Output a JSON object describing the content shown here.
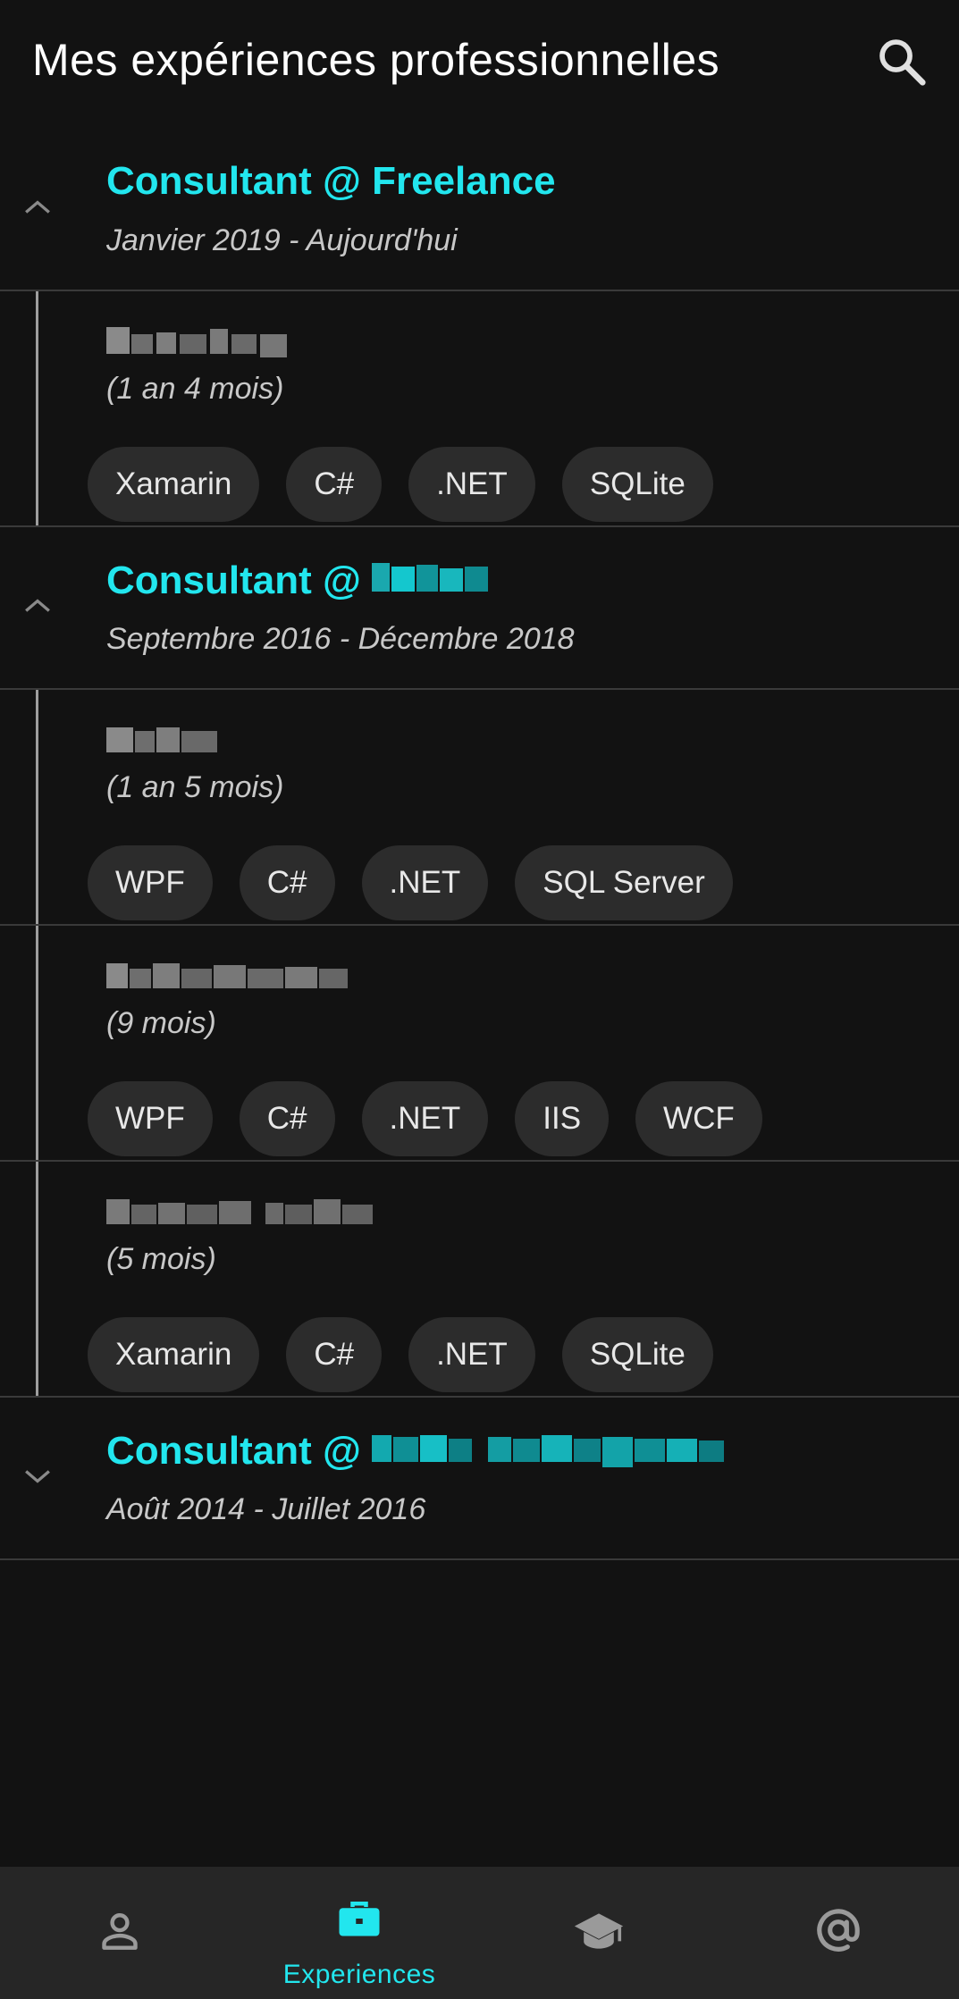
{
  "header": {
    "title": "Mes expériences professionnelles",
    "search_icon": "search-icon"
  },
  "groups": [
    {
      "company": "Consultant @ Freelance",
      "period": "Janvier 2019 - Aujourd'hui",
      "expanded": true,
      "entries": [
        {
          "client": "Bevolving",
          "duration": "(1 an 4 mois)",
          "tags": [
            "Xamarin",
            "C#",
            ".NET",
            "SQLite"
          ]
        }
      ]
    },
    {
      "company_prefix": "Consultant @ ",
      "company_name_redacted": "Prodis",
      "period": "Septembre 2016 - Décembre 2018",
      "expanded": true,
      "entries": [
        {
          "client": "Vitalis",
          "duration": "(1 an 5 mois)",
          "tags": [
            "WPF",
            "C#",
            ".NET",
            "SQL Server"
          ]
        },
        {
          "client": "G-Smartware",
          "duration": "(9 mois)",
          "tags": [
            "WPF",
            "C#",
            ".NET",
            "IIS",
            "WCF"
          ]
        },
        {
          "client": "Bernardaux Labs",
          "duration": "(5 mois)",
          "tags": [
            "Xamarin",
            "C#",
            ".NET",
            "SQLite"
          ]
        }
      ]
    },
    {
      "company_prefix": "Consultant @ ",
      "company_name_redacted": "IMAS technologies",
      "period": "Août 2014 - Juillet 2016",
      "expanded": false,
      "entries": []
    }
  ],
  "bottom_nav": {
    "items": [
      {
        "icon": "person-icon",
        "label": "",
        "active": false
      },
      {
        "icon": "briefcase-icon",
        "label": "Experiences",
        "active": true
      },
      {
        "icon": "graduation-cap-icon",
        "label": "",
        "active": false
      },
      {
        "icon": "at-sign-icon",
        "label": "",
        "active": false
      }
    ]
  },
  "colors": {
    "accent": "#22e6ee",
    "background": "#121212",
    "chip": "#2c2c2c",
    "nav_background": "#262626"
  }
}
